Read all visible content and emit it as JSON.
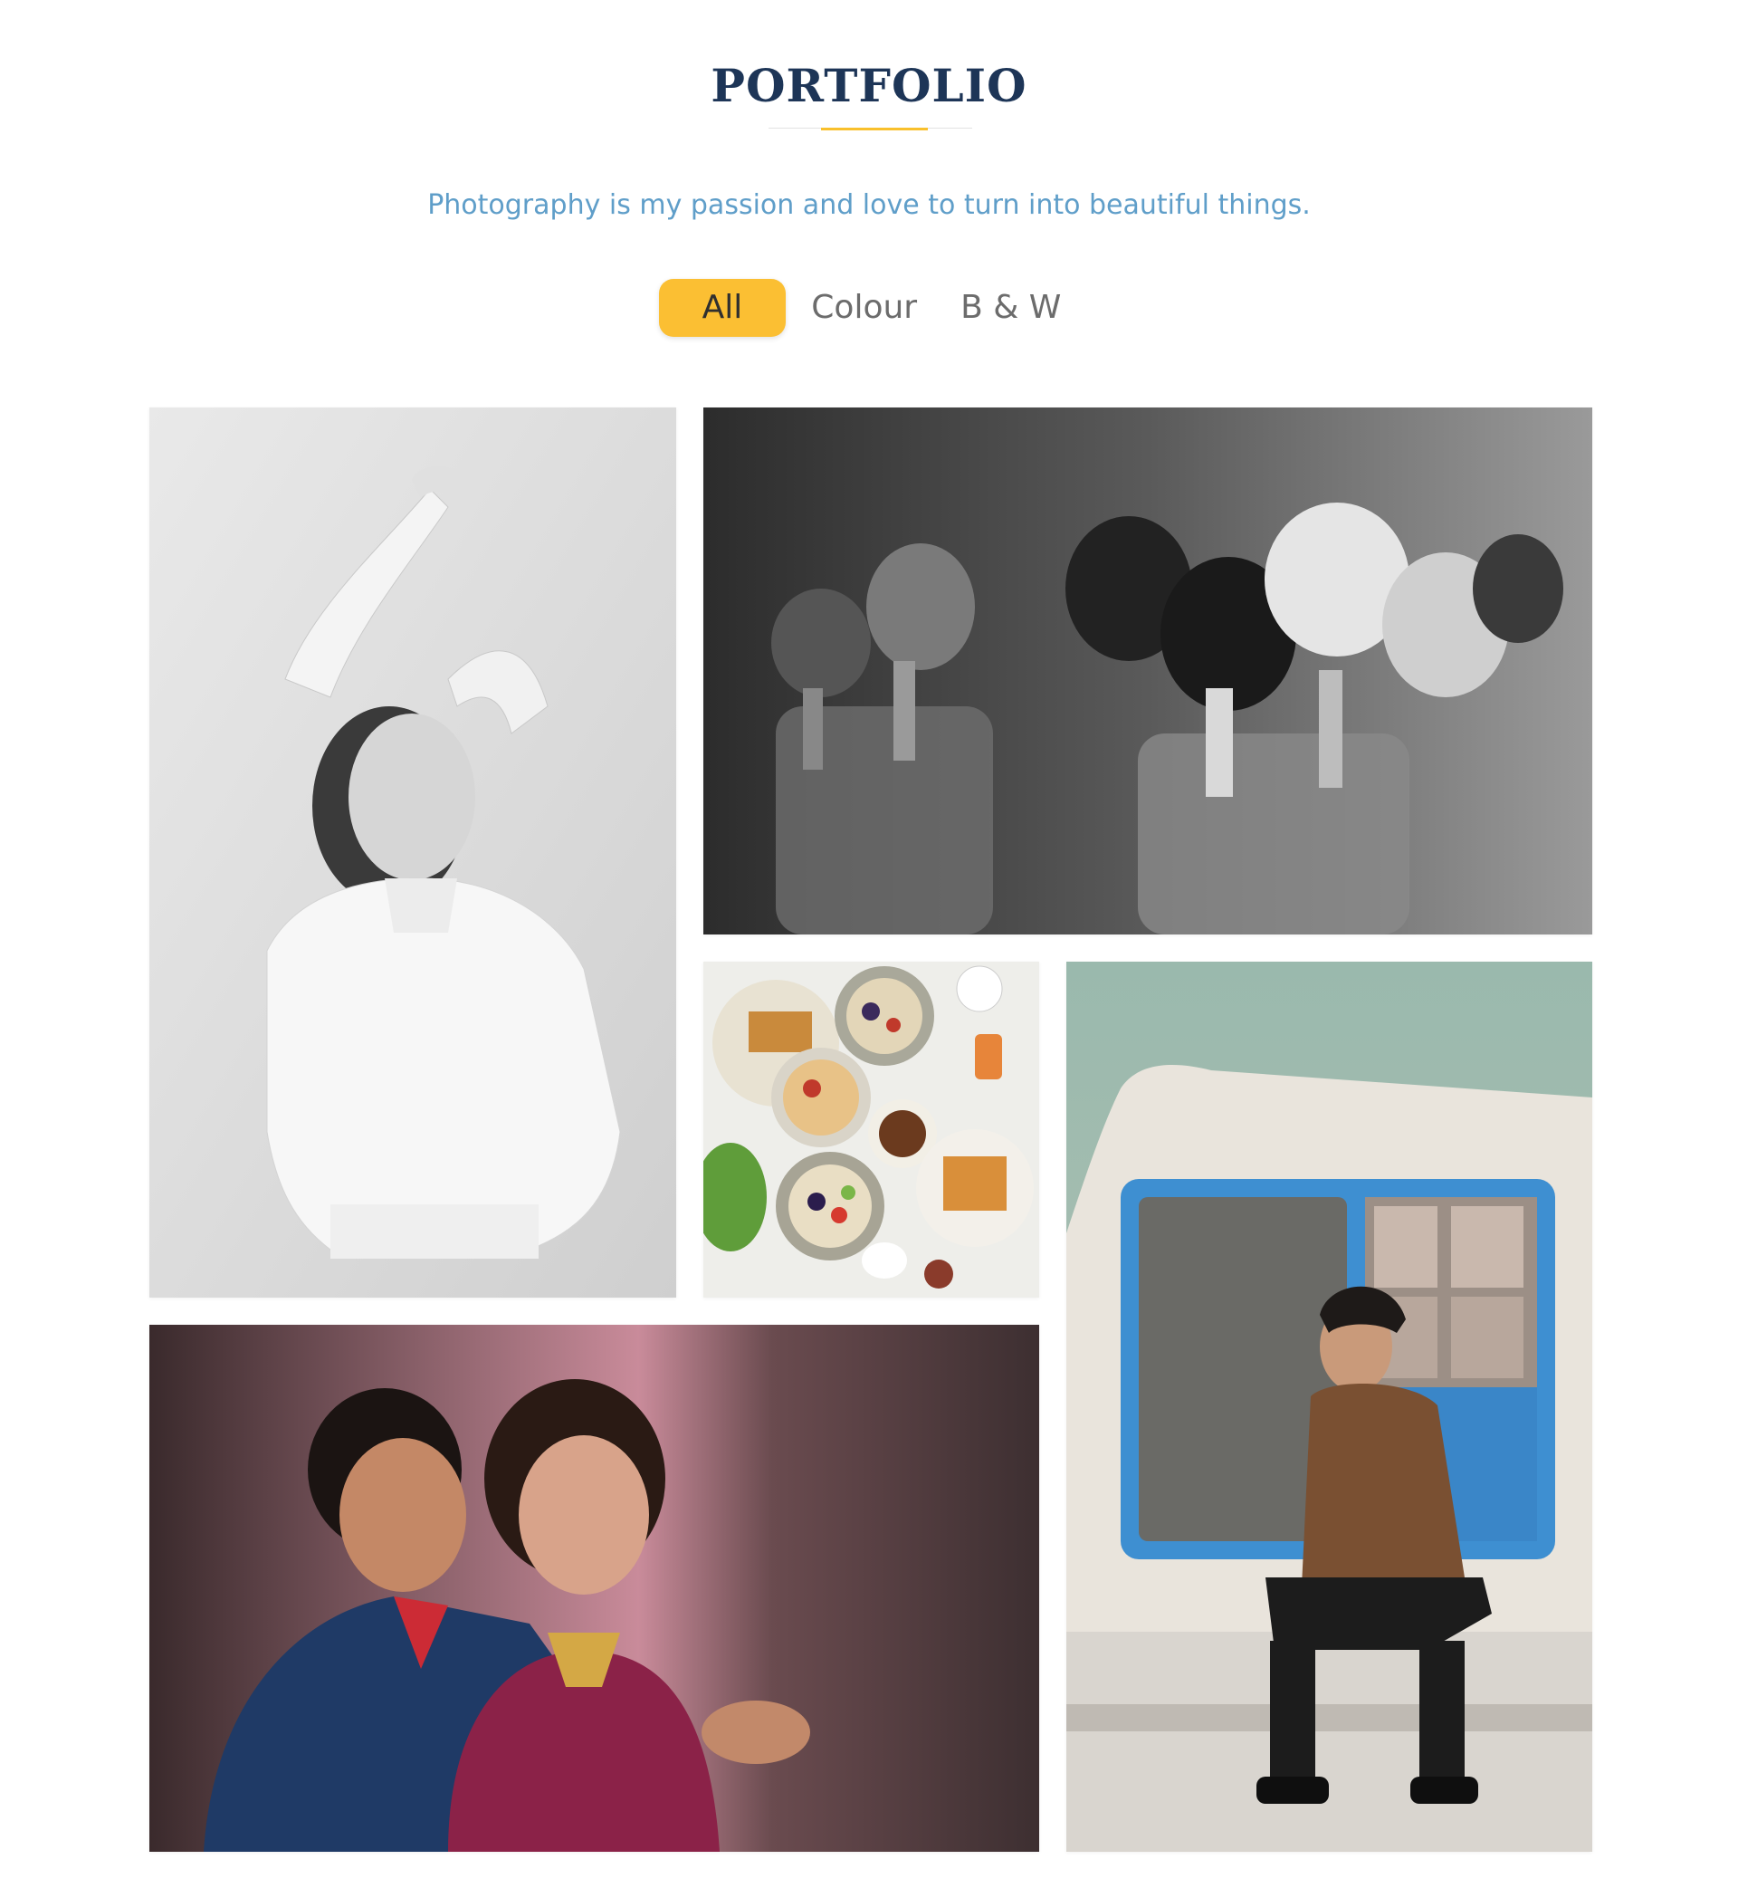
{
  "section": {
    "title": "PORTFOLIO",
    "subtitle": "Photography is my passion and love to turn into beautiful things."
  },
  "filters": [
    {
      "label": "All",
      "active": true
    },
    {
      "label": "Colour",
      "active": false
    },
    {
      "label": "B & W",
      "active": false
    }
  ],
  "colors": {
    "title": "#1d3557",
    "accent": "#fbbf33",
    "subtitle": "#5f9ec9",
    "filter_text": "#6c6c6c"
  },
  "gallery": [
    {
      "category": "B & W",
      "subject": "woman-portrait-bw"
    },
    {
      "category": "B & W",
      "subject": "makeup-brushes-bw"
    },
    {
      "category": "Colour",
      "subject": "breakfast-food"
    },
    {
      "category": "Colour",
      "subject": "man-sitting-blue-window"
    },
    {
      "category": "Colour",
      "subject": "couple-portrait"
    }
  ]
}
